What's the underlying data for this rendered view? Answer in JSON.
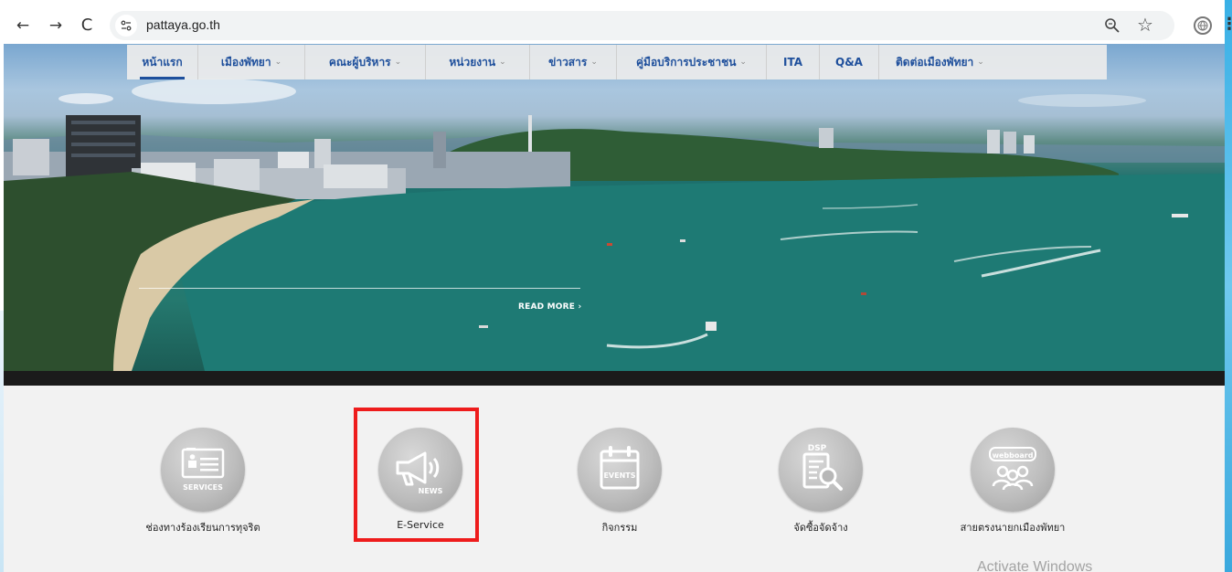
{
  "browser": {
    "url": "pattaya.go.th",
    "back_glyph": "←",
    "forward_glyph": "→",
    "reload_glyph": "C",
    "bookmark_glyph": "☆",
    "menu_glyph": "⋮"
  },
  "site_nav": {
    "items": [
      {
        "label": "หน้าแรก",
        "has_dropdown": false,
        "active": true
      },
      {
        "label": "เมืองพัทยา",
        "has_dropdown": true,
        "active": false
      },
      {
        "label": "คณะผู้บริหาร",
        "has_dropdown": true,
        "active": false
      },
      {
        "label": "หน่วยงาน",
        "has_dropdown": true,
        "active": false
      },
      {
        "label": "ข่าวสาร",
        "has_dropdown": true,
        "active": false
      },
      {
        "label": "คู่มือบริการประชาชน",
        "has_dropdown": true,
        "active": false
      },
      {
        "label": "ITA",
        "has_dropdown": false,
        "active": false
      },
      {
        "label": "Q&A",
        "has_dropdown": false,
        "active": false
      },
      {
        "label": "ติดต่อเมืองพัทยา",
        "has_dropdown": true,
        "active": false
      }
    ],
    "caret_glyph": "⌄"
  },
  "hero": {
    "read_more": "READ MORE ›"
  },
  "services": {
    "items": [
      {
        "label": "ช่องทางร้องเรียนการทุจริต",
        "icon": "services-icon",
        "icon_text": "SERVICES"
      },
      {
        "label": "E-Service",
        "icon": "news-megaphone-icon",
        "icon_text": "NEWS"
      },
      {
        "label": "กิจกรรม",
        "icon": "events-calendar-icon",
        "icon_text": "EVENTS"
      },
      {
        "label": "จัดซื้อจัดจ้าง",
        "icon": "dsp-document-icon",
        "icon_text": "DSP"
      },
      {
        "label": "สายตรงนายกเมืองพัทยา",
        "icon": "webboard-icon",
        "icon_text": "webboard"
      }
    ]
  },
  "overlay": {
    "watermark": "Activate Windows",
    "highlight_color": "#ee1c1c"
  },
  "colors": {
    "nav_text": "#1e4f9c",
    "services_bg": "#f2f2f2"
  }
}
